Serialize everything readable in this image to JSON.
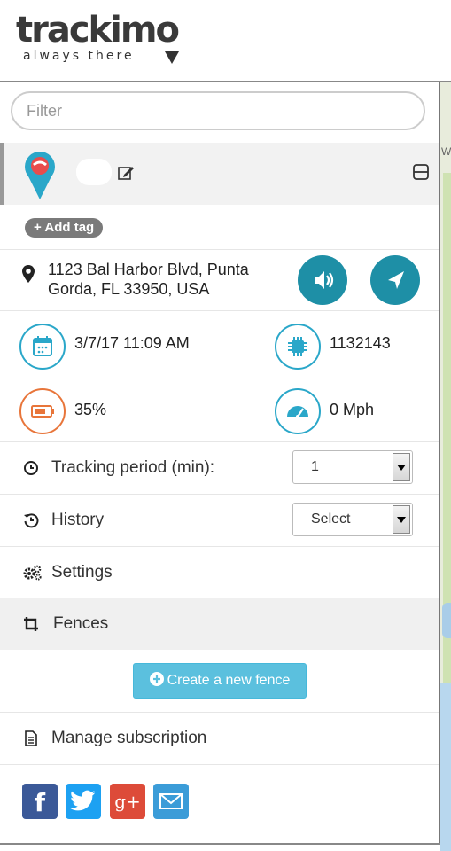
{
  "brand": {
    "name": "trackimo",
    "tagline": "always there"
  },
  "filter": {
    "placeholder": "Filter"
  },
  "device": {
    "tag_button": "+ Add tag",
    "address": "1123 Bal Harbor Blvd, Punta Gorda, FL 33950, USA",
    "datetime": "3/7/17 11:09 AM",
    "device_id": "1132143",
    "battery": "35%",
    "speed": "0 Mph"
  },
  "menu": {
    "tracking_label": "Tracking period (min):",
    "tracking_value": "1",
    "history_label": "History",
    "history_value": "Select",
    "settings_label": "Settings",
    "fences_label": "Fences",
    "create_fence": "Create a new fence",
    "subscription_label": "Manage subscription"
  },
  "map": {
    "label_fragment": "W"
  },
  "social": [
    "f",
    "g+"
  ],
  "colors": {
    "accent": "#1e8fa6",
    "ring": "#2aa7c9",
    "battery": "#e8753a",
    "fence_button": "#5bc0de",
    "facebook": "#3b5998",
    "twitter": "#1da1f2",
    "google": "#dd4b39",
    "email": "#3b9cd8"
  }
}
